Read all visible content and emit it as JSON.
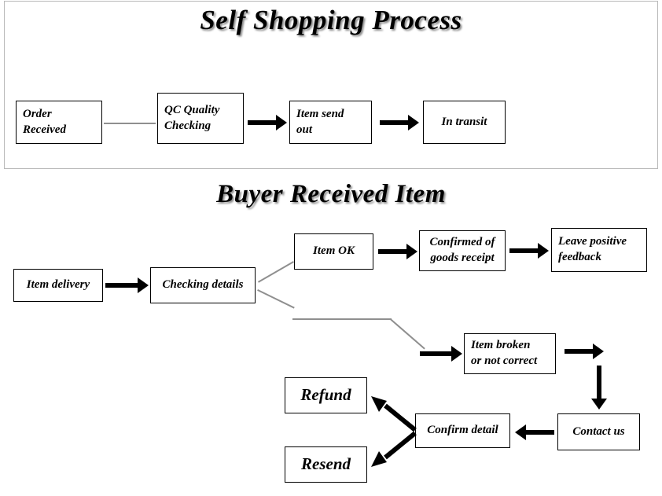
{
  "document": {
    "top_section": {
      "title": "Self Shopping Process",
      "nodes": [
        {
          "id": "order-received",
          "lines": [
            "Order",
            "Received"
          ]
        },
        {
          "id": "qc-quality-checking",
          "lines": [
            "QC Quality",
            "Checking"
          ]
        },
        {
          "id": "item-send-out",
          "lines": [
            "Item send",
            "out"
          ]
        },
        {
          "id": "in-transit",
          "lines": [
            "In transit"
          ]
        }
      ],
      "connectors": [
        {
          "from": "order-received",
          "to": "qc-quality-checking",
          "style": "plain-line"
        },
        {
          "from": "qc-quality-checking",
          "to": "item-send-out",
          "style": "arrow-right"
        },
        {
          "from": "item-send-out",
          "to": "in-transit",
          "style": "arrow-right"
        }
      ]
    },
    "bottom_section": {
      "title": "Buyer Received Item",
      "nodes": [
        {
          "id": "item-delivery",
          "lines": [
            "Item delivery"
          ]
        },
        {
          "id": "checking-details",
          "lines": [
            "Checking details"
          ]
        },
        {
          "id": "item-ok",
          "lines": [
            "Item OK"
          ]
        },
        {
          "id": "confirmed-of-goods-receipt",
          "lines": [
            "Confirmed of",
            "goods receipt"
          ]
        },
        {
          "id": "leave-positive-feedback",
          "lines": [
            "Leave positive",
            "feedback"
          ]
        },
        {
          "id": "item-broken-or-not-correct",
          "lines": [
            "Item broken",
            "or not correct"
          ]
        },
        {
          "id": "contact-us",
          "lines": [
            "Contact us"
          ]
        },
        {
          "id": "confirm-detail",
          "lines": [
            "Confirm detail"
          ]
        },
        {
          "id": "refund",
          "lines": [
            "Refund"
          ]
        },
        {
          "id": "resend",
          "lines": [
            "Resend"
          ]
        }
      ],
      "connectors": [
        {
          "from": "item-delivery",
          "to": "checking-details",
          "style": "arrow-right"
        },
        {
          "from": "checking-details",
          "to": "item-ok",
          "style": "branch-line-up"
        },
        {
          "from": "item-ok",
          "to": "confirmed-of-goods-receipt",
          "style": "arrow-right"
        },
        {
          "from": "confirmed-of-goods-receipt",
          "to": "leave-positive-feedback",
          "style": "arrow-right"
        },
        {
          "from": "checking-details",
          "to": "item-broken-or-not-correct",
          "style": "branch-line-down"
        },
        {
          "from": "item-broken-or-not-correct",
          "to": "contact-us",
          "style": "arrow-right-then-down"
        },
        {
          "from": "contact-us",
          "to": "confirm-detail",
          "style": "arrow-left"
        },
        {
          "from": "confirm-detail",
          "to": "refund",
          "style": "arrow-up-left"
        },
        {
          "from": "confirm-detail",
          "to": "resend",
          "style": "arrow-down-left"
        }
      ]
    },
    "colors": {
      "background": "#ffffff",
      "node_border": "#000000",
      "text": "#000000",
      "panel_border": "#b9b9b9",
      "thin_connector": "#8f8f8f"
    }
  }
}
